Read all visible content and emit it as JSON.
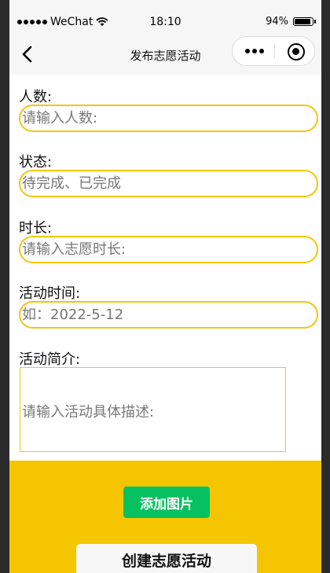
{
  "status_bar": {
    "carrier": "WeChat",
    "time": "18:10",
    "battery_percent": "94%",
    "battery_level": 0.94
  },
  "nav": {
    "back_icon": "chevron-left-icon",
    "title": "发布志愿活动",
    "capsule_icons": [
      "more-icon",
      "target-icon"
    ]
  },
  "form": {
    "people": {
      "label": "人数:",
      "placeholder": "请输入人数:"
    },
    "status": {
      "label": "状态:",
      "placeholder": "待完成、已完成"
    },
    "duration": {
      "label": "时长:",
      "placeholder": "请输入志愿时长:"
    },
    "time": {
      "label": "活动时间:",
      "placeholder": "如：2022-5-12"
    },
    "intro": {
      "label": "活动简介:",
      "placeholder": "请输入活动具体描述:"
    }
  },
  "actions": {
    "add_image": "添加图片",
    "create": "创建志愿活动"
  },
  "colors": {
    "accent_yellow": "#f5c600",
    "field_border": "#f2c60e",
    "green_button": "#07c160"
  }
}
